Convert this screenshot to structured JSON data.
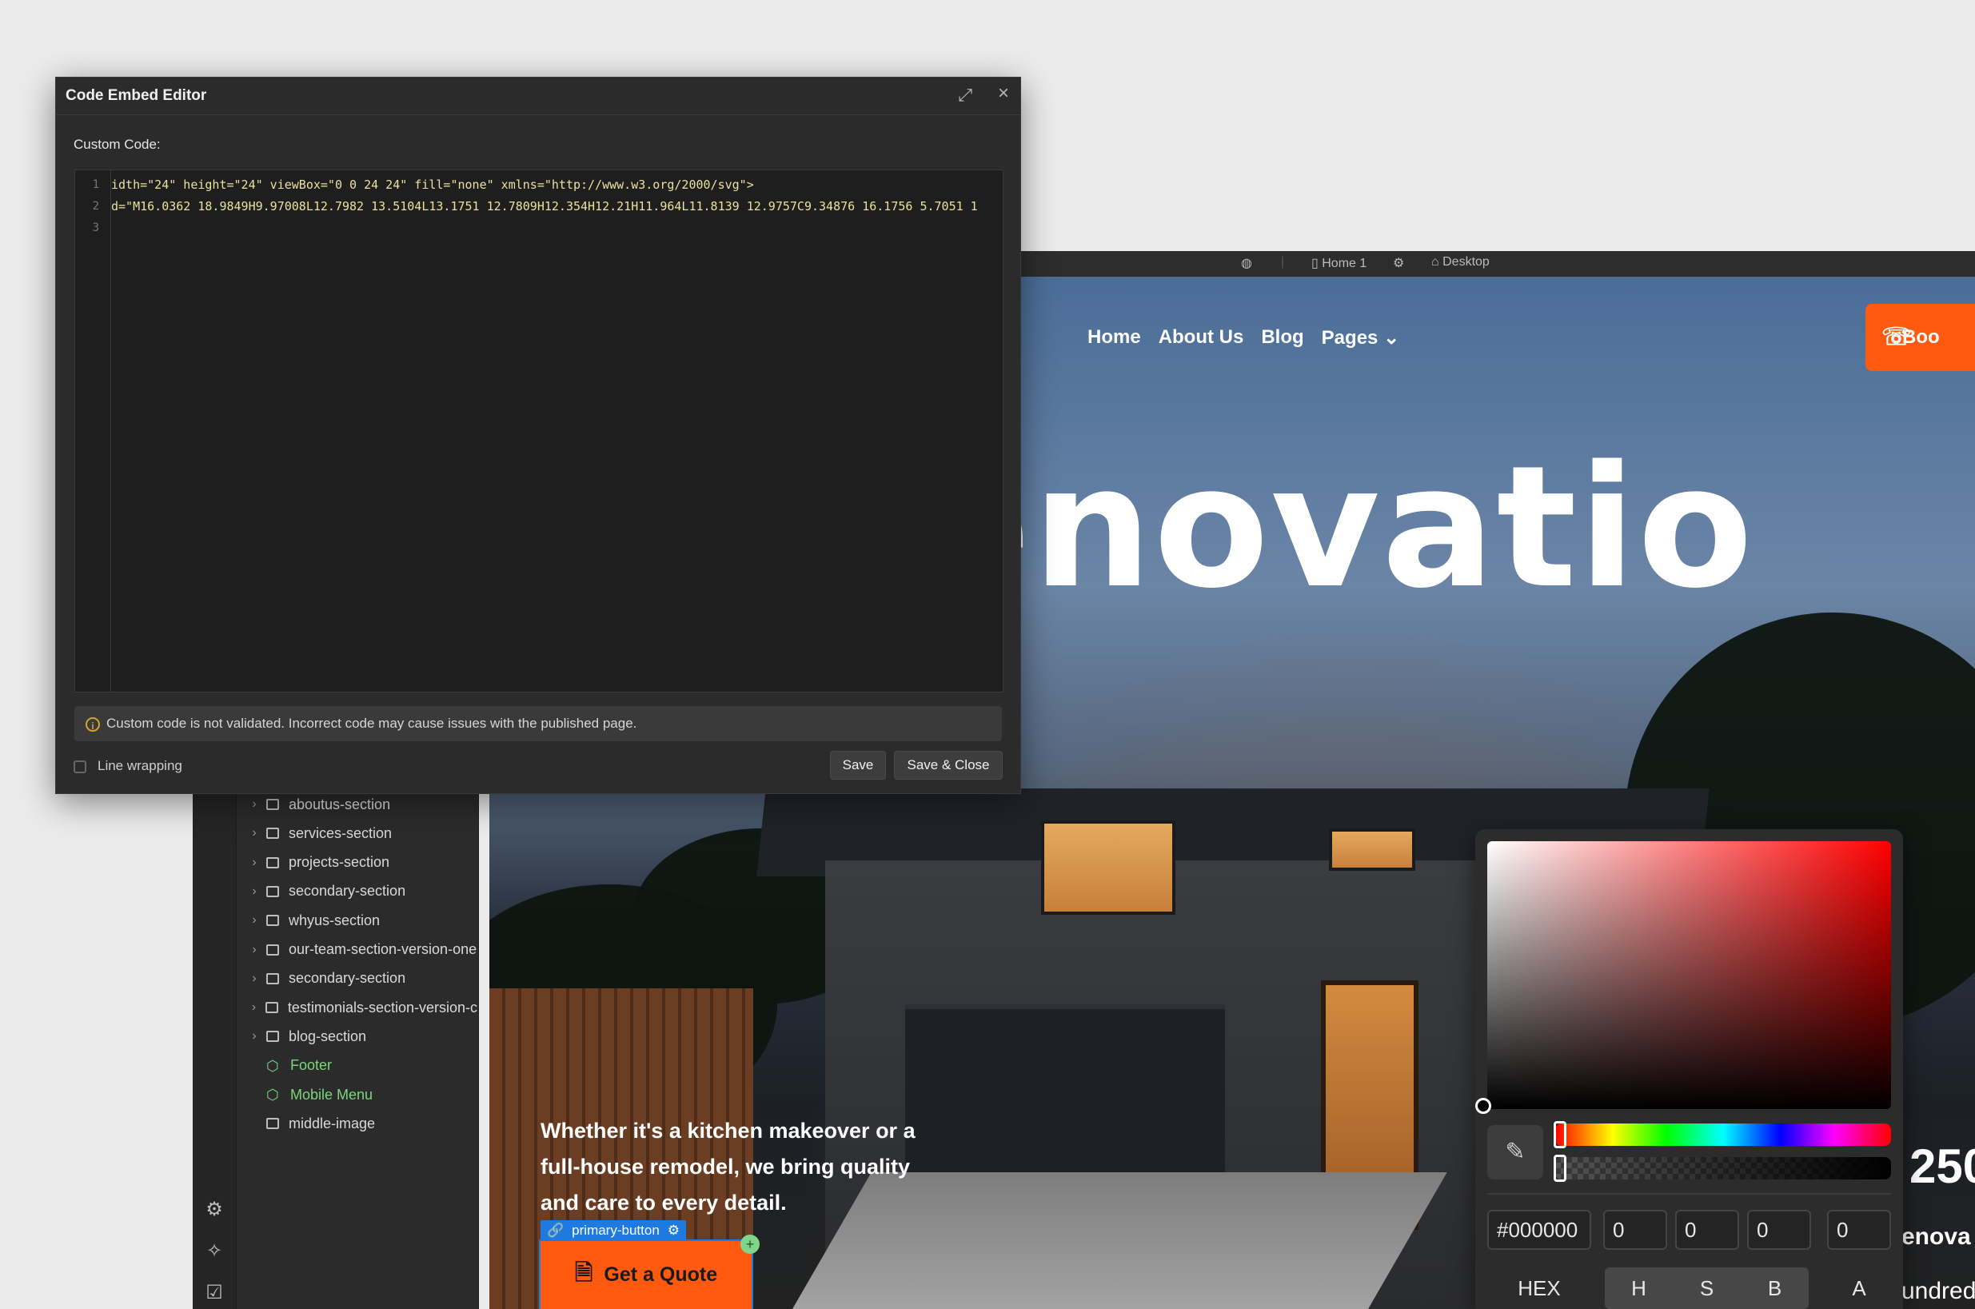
{
  "dialog": {
    "title": "Code Embed Editor",
    "expand_icon": "expand-icon",
    "close_icon": "close-icon",
    "custom_code_label": "Custom Code:",
    "code_lines": [
      {
        "num": "1",
        "text": "idth=\"24\" height=\"24\" viewBox=\"0 0 24 24\" fill=\"none\" xmlns=\"http://www.w3.org/2000/svg\">"
      },
      {
        "num": "2",
        "text": "d=\"M16.0362 18.9849H9.97008L12.7982 13.5104L13.1751 12.7809H12.354H12.21H11.964L11.8139 12.9757C9.34876 16.1756 5.7051 1"
      },
      {
        "num": "3",
        "text": ""
      }
    ],
    "warning_text": "Custom code is not validated. Incorrect code may cause issues with the published page.",
    "line_wrapping_label": "Line wrapping",
    "save_label": "Save",
    "save_close_label": "Save & Close"
  },
  "canvas_topbar": {
    "page_label": "Home 1",
    "device_label": "Desktop"
  },
  "site": {
    "nav": [
      "Home",
      "About Us",
      "Blog",
      "Pages"
    ],
    "book_label": "Boo",
    "hero_title": "za Renovatio",
    "hero_subtitle": "Whether it's a kitchen makeover or a full-house remodel, we bring quality and care to every detail.",
    "selected_tag": "primary-button",
    "quote_label": "Get a Quote",
    "stat_number": "250",
    "stat_label_1": "enova",
    "stat_label_2": "undreds"
  },
  "navigator": {
    "layers": [
      {
        "label": "aboutus-section",
        "type": "section"
      },
      {
        "label": "services-section",
        "type": "section"
      },
      {
        "label": "projects-section",
        "type": "section"
      },
      {
        "label": "secondary-section",
        "type": "section"
      },
      {
        "label": "whyus-section",
        "type": "section"
      },
      {
        "label": "our-team-section-version-one",
        "type": "section"
      },
      {
        "label": "secondary-section",
        "type": "section"
      },
      {
        "label": "testimonials-section-version-c",
        "type": "section"
      },
      {
        "label": "blog-section",
        "type": "section"
      },
      {
        "label": "Footer",
        "type": "component"
      },
      {
        "label": "Mobile Menu",
        "type": "component"
      },
      {
        "label": "middle-image",
        "type": "image"
      }
    ]
  },
  "color_picker": {
    "hex_value": "#000000",
    "h": "0",
    "s": "0",
    "b": "0",
    "a": "0",
    "modes": [
      "HEX",
      "H",
      "S",
      "B",
      "A"
    ],
    "hue_fraction": 0,
    "alpha_fraction": 0
  },
  "colors": {
    "accent_orange": "#ff5a0f",
    "selection_blue": "#1f7ae0",
    "component_green": "#7bd67b"
  }
}
